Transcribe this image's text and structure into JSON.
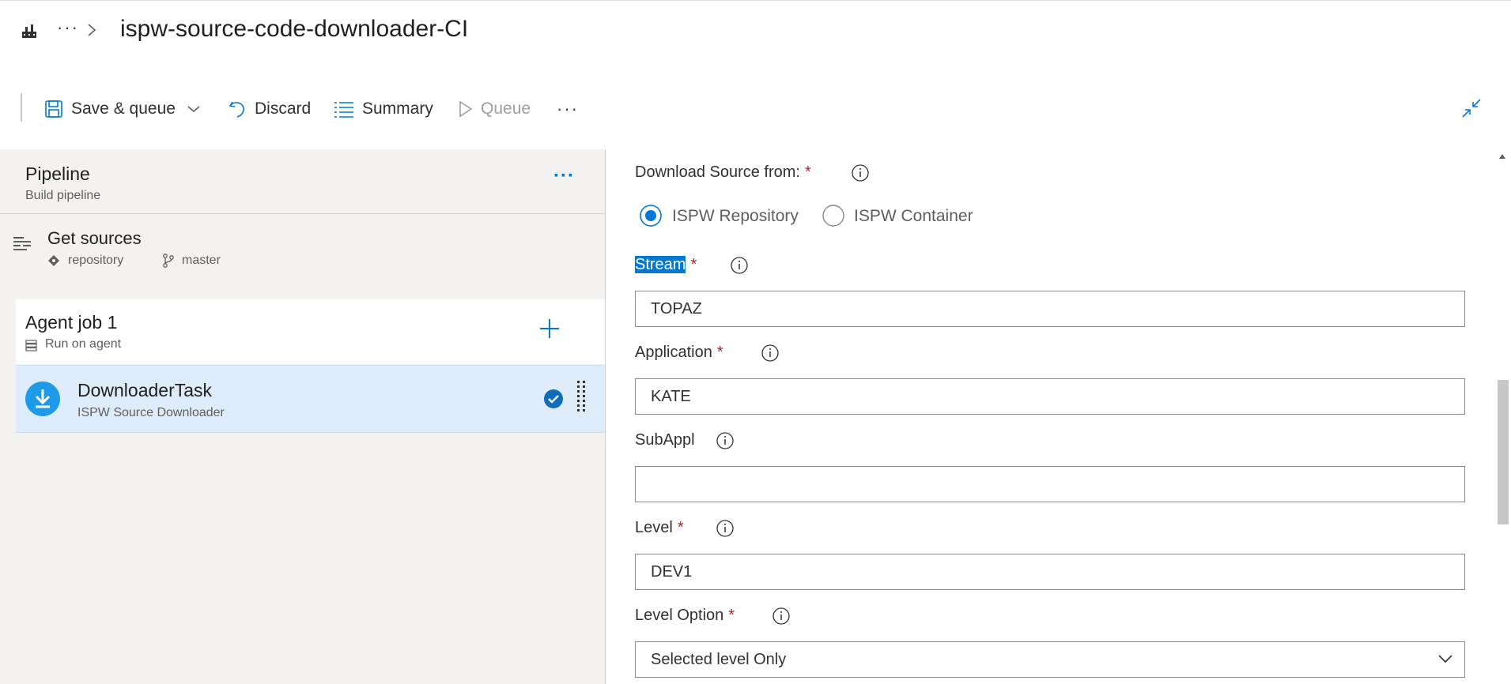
{
  "header": {
    "breadcrumb_more": "···",
    "title": "ispw-source-code-downloader-CI",
    "home_icon": "build-pipeline-icon"
  },
  "toolbar": {
    "save_queue_label": "Save & queue",
    "discard_label": "Discard",
    "summary_label": "Summary",
    "queue_label": "Queue",
    "more_label": "···"
  },
  "left_panel": {
    "pipeline": {
      "title": "Pipeline",
      "subtitle": "Build pipeline",
      "more": "···"
    },
    "get_sources": {
      "title": "Get sources",
      "repository": "repository",
      "branch": "master"
    },
    "agent_job": {
      "title": "Agent job 1",
      "subtitle": "Run on agent"
    },
    "task": {
      "title": "DownloaderTask",
      "subtitle": "ISPW Source Downloader"
    }
  },
  "form": {
    "download_source": {
      "label": "Download Source from:",
      "required": "*",
      "options": [
        {
          "label": "ISPW Repository",
          "selected": true
        },
        {
          "label": "ISPW Container",
          "selected": false
        }
      ]
    },
    "stream": {
      "label": "Stream",
      "required": "*",
      "value": "TOPAZ"
    },
    "application": {
      "label": "Application",
      "required": "*",
      "value": "KATE"
    },
    "subappl": {
      "label": "SubAppl",
      "value": ""
    },
    "level": {
      "label": "Level",
      "required": "*",
      "value": "DEV1"
    },
    "level_option": {
      "label": "Level Option",
      "required": "*",
      "value": "Selected level Only"
    }
  },
  "colors": {
    "accent": "#0078d4",
    "task_selected_bg": "#deecf9",
    "required": "#a4262c",
    "panel_bg": "#f3f2f1"
  }
}
